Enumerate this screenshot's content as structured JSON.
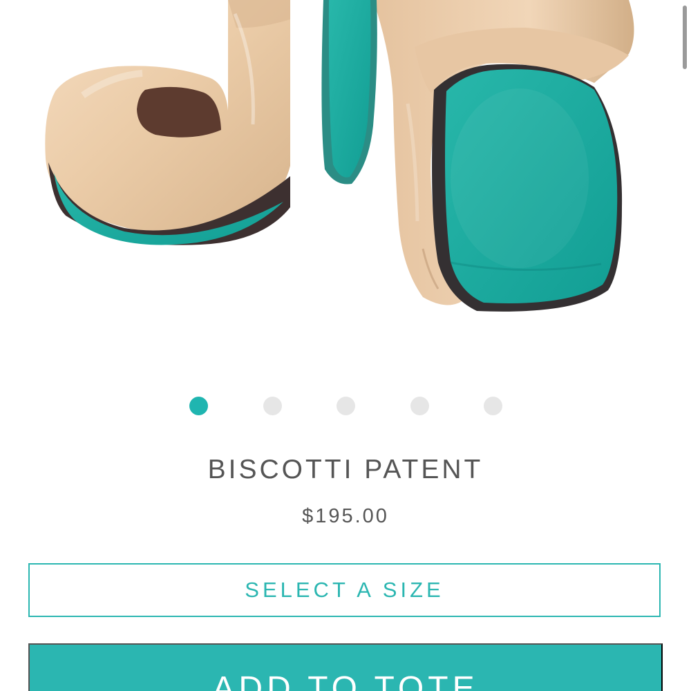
{
  "product": {
    "name": "BISCOTTI PATENT",
    "price": "$195.00"
  },
  "carousel": {
    "total": 5,
    "active_index": 1,
    "active_color": "#1fb5b0",
    "inactive_color": "#e6e6e6"
  },
  "actions": {
    "select_size_label": "SELECT A SIZE",
    "add_to_tote_label": "ADD TO TOTE"
  },
  "theme": {
    "accent": "#2bb6b1",
    "text": "#555555"
  },
  "image": {
    "icon": "product-photo"
  }
}
